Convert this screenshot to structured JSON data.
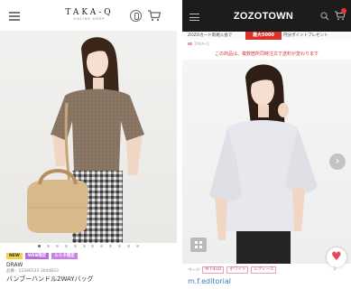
{
  "left": {
    "logo": "TAKA-Q",
    "logo_sub": "ONLINE SHOP",
    "tags": [
      "NEW",
      "WEB限定",
      "ルミネ限定"
    ],
    "brand": "DRAW",
    "code": "品番：12346533 3044833",
    "product_name": "バンブーハンドル2WAYバッグ",
    "carousel_dots": 12
  },
  "right": {
    "logo": "ZOZOTOWN",
    "banner_text_left": "ZOZOカード新規入会で",
    "banner_badge": "最大5000",
    "banner_text_right": "円分ポイントプレゼント",
    "breadcrumb": "TAKA-Q",
    "notice": "この商品は、複数箇所同時注文で送料が変わります",
    "meta_label": "ページ",
    "meta_pills": [
      "M FIELD",
      "ホワイト",
      "レディース"
    ],
    "fav_count": "2",
    "brand": "m.f.editorial"
  },
  "colors": {
    "zozo_header": "#1c1c1c",
    "zozo_accent": "#d9342b",
    "link_blue": "#3a7fb8",
    "heart": "#e8465a",
    "tag_new": "#f3d34a",
    "tag_purple": "#b76ad8"
  }
}
